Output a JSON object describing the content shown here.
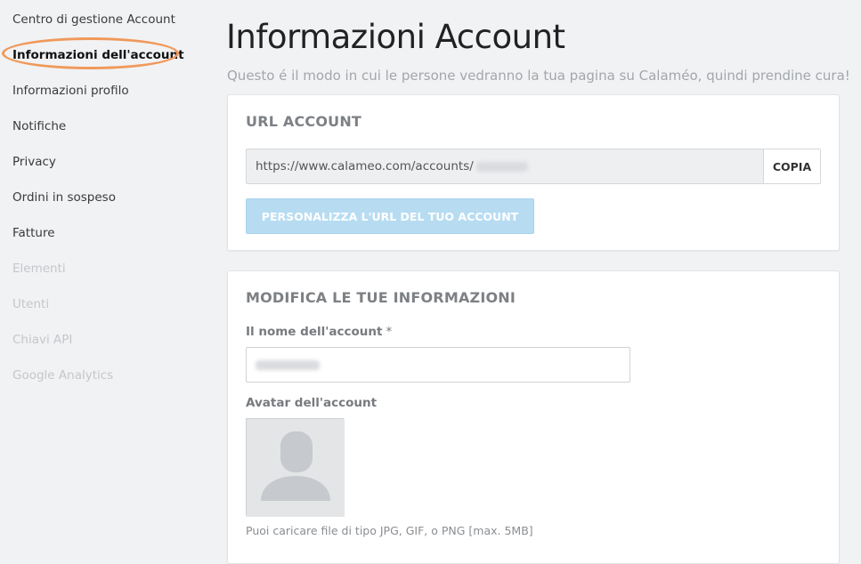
{
  "sidebar": {
    "items": [
      {
        "label": "Centro di gestione Account",
        "state": "normal"
      },
      {
        "label": "Informazioni dell'account",
        "state": "active"
      },
      {
        "label": "Informazioni profilo",
        "state": "normal"
      },
      {
        "label": "Notifiche",
        "state": "normal"
      },
      {
        "label": "Privacy",
        "state": "normal"
      },
      {
        "label": "Ordini in sospeso",
        "state": "normal"
      },
      {
        "label": "Fatture",
        "state": "normal"
      },
      {
        "label": "Elementi",
        "state": "disabled"
      },
      {
        "label": "Utenti",
        "state": "disabled"
      },
      {
        "label": "Chiavi API",
        "state": "disabled"
      },
      {
        "label": "Google Analytics",
        "state": "disabled"
      }
    ]
  },
  "header": {
    "title": "Informazioni Account",
    "subtitle": "Questo é il modo in cui le persone vedranno la tua pagina su Calaméo, quindi prendine cura!"
  },
  "url_card": {
    "title": "URL ACCOUNT",
    "url_value": "https://www.calameo.com/accounts/",
    "copy_label": "COPIA",
    "customize_label": "PERSONALIZZA L'URL DEL TUO ACCOUNT"
  },
  "info_card": {
    "title": "MODIFICA LE TUE INFORMAZIONI",
    "name_label": "Il nome dell'account",
    "required_mark": "*",
    "avatar_label": "Avatar dell'account",
    "upload_hint": "Puoi caricare file di tipo JPG, GIF, o PNG [max. 5MB]"
  },
  "colors": {
    "highlight_ring": "#f0995a",
    "primary_button": "#b7dcf2",
    "background": "#f1f2f4"
  }
}
